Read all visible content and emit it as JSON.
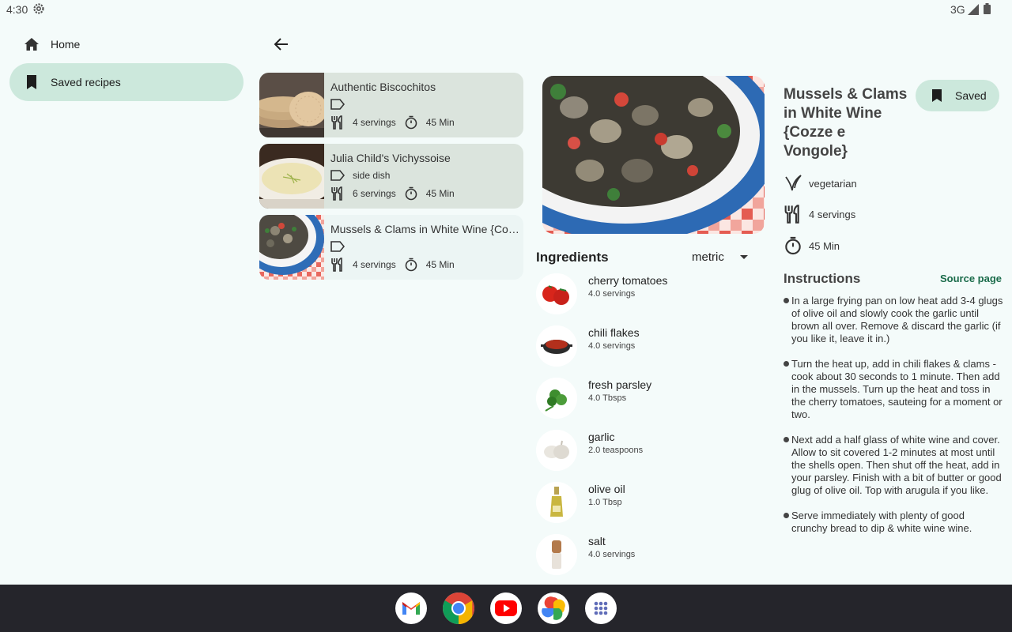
{
  "status_bar": {
    "time": "4:30",
    "network": "3G"
  },
  "nav": {
    "items": [
      {
        "label": "Home",
        "icon": "home-icon",
        "active": false
      },
      {
        "label": "Saved recipes",
        "icon": "bookmark-icon",
        "active": true
      }
    ]
  },
  "recipes": [
    {
      "title": "Authentic Biscochitos",
      "tag": "",
      "servings": "4 servings",
      "time": "45 Min"
    },
    {
      "title": "Julia Child's Vichyssoise",
      "tag": "side dish",
      "servings": "6 servings",
      "time": "45 Min"
    },
    {
      "title": "Mussels & Clams in White Wine {Cozzé e Vongole}",
      "tag": "",
      "servings": "4 servings",
      "time": "45 Min"
    }
  ],
  "detail": {
    "title": "Mussels & Clams in White Wine {Cozze e Vongole}",
    "saved_label": "Saved",
    "diet": "vegetarian",
    "servings": "4 servings",
    "time": "45 Min",
    "ingredients_title": "Ingredients",
    "unit_system": "metric",
    "ingredients": [
      {
        "name": "cherry tomatoes",
        "qty": "4.0 servings"
      },
      {
        "name": "chili flakes",
        "qty": "4.0 servings"
      },
      {
        "name": "fresh parsley",
        "qty": "4.0 Tbsps"
      },
      {
        "name": "garlic",
        "qty": "2.0 teaspoons"
      },
      {
        "name": "olive oil",
        "qty": "1.0 Tbsp"
      },
      {
        "name": "salt",
        "qty": "4.0 servings"
      }
    ],
    "instructions_title": "Instructions",
    "source_label": "Source page",
    "steps": [
      "In a large frying pan on low heat add 3-4 glugs of olive oil and slowly cook the garlic until brown all over. Remove & discard the garlic (if you like it, leave it in.)",
      "Turn the heat up, add in chili flakes & clams - cook about 30 seconds to 1 minute. Then add in the mussels. Turn up the heat and toss in the cherry tomatoes, sauteing for a moment or two.",
      "Next add a half glass of white wine and cover. Allow to sit covered 1-2 minutes at most until the shells open. Then shut off the heat, add in your parsley. Finish with a bit of butter or good glug of olive oil. Top with arugula if you like.",
      "Serve immediately with plenty of good crunchy bread to dip & white wine wine."
    ]
  },
  "taskbar": {
    "apps": [
      "gmail-icon",
      "chrome-icon",
      "youtube-icon",
      "photos-icon",
      "app-drawer-icon"
    ]
  },
  "colors": {
    "background": "#f4fbfa",
    "accent": "#cce8dc",
    "link": "#1a6b4a",
    "taskbar": "#25252b"
  }
}
